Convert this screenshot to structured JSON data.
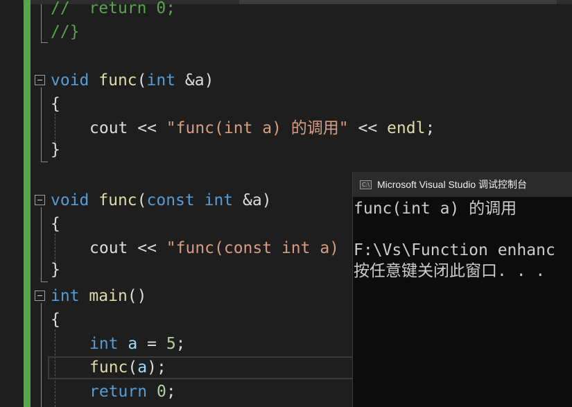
{
  "editor": {
    "lines": {
      "l1": [
        "//",
        "  ",
        "return",
        " ",
        "0",
        ";"
      ],
      "l2": [
        "//}"
      ],
      "l3": [
        "void",
        " ",
        "func",
        "(",
        "int",
        " ",
        "&a",
        ")"
      ],
      "l4": [
        "{"
      ],
      "l5": [
        "cout",
        " << ",
        "\"func(int a) 的调用\"",
        " << ",
        "endl",
        ";"
      ],
      "l6": [
        "}"
      ],
      "l7": [
        "void",
        " ",
        "func",
        "(",
        "const",
        " ",
        "int",
        " ",
        "&a",
        ")"
      ],
      "l8": [
        "{"
      ],
      "l9": [
        "cout",
        " << ",
        "\"func(const int a)"
      ],
      "l10": [
        "}"
      ],
      "l11": [
        "int",
        " ",
        "main",
        "()"
      ],
      "l12": [
        "{"
      ],
      "l13": [
        "int",
        " ",
        "a",
        " = ",
        "5",
        ";"
      ],
      "l14": [
        "func",
        "(",
        "a",
        ");"
      ],
      "l15": [
        "return",
        " ",
        "0",
        ";"
      ]
    }
  },
  "console": {
    "title": "Microsoft Visual Studio 调试控制台",
    "icon_name": "console-app-icon",
    "icon_text": "C:\\",
    "output": [
      "func(int a) 的调用",
      "",
      "F:\\Vs\\Function enhanc",
      "按任意键关闭此窗口. . ."
    ]
  }
}
